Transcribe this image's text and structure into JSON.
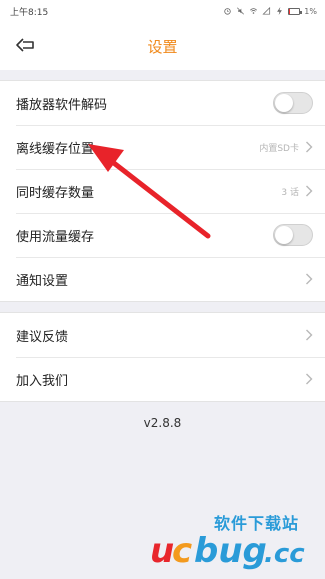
{
  "status": {
    "time": "上午8:15",
    "battery": "1%"
  },
  "header": {
    "title": "设置"
  },
  "settings_group": [
    {
      "label": "播放器软件解码",
      "toggle": false
    },
    {
      "label": "离线缓存位置",
      "value": "内置SD卡"
    },
    {
      "label": "同时缓存数量",
      "value": "3 话"
    },
    {
      "label": "使用流量缓存",
      "toggle": false
    },
    {
      "label": "通知设置"
    }
  ],
  "about_group": [
    {
      "label": "建议反馈"
    },
    {
      "label": "加入我们"
    }
  ],
  "version": "v2.8.8",
  "annotation": {
    "color": "#e8232a"
  },
  "watermark": {
    "text_cn": "软件下载站",
    "logo_text": "ucbug.cc"
  }
}
